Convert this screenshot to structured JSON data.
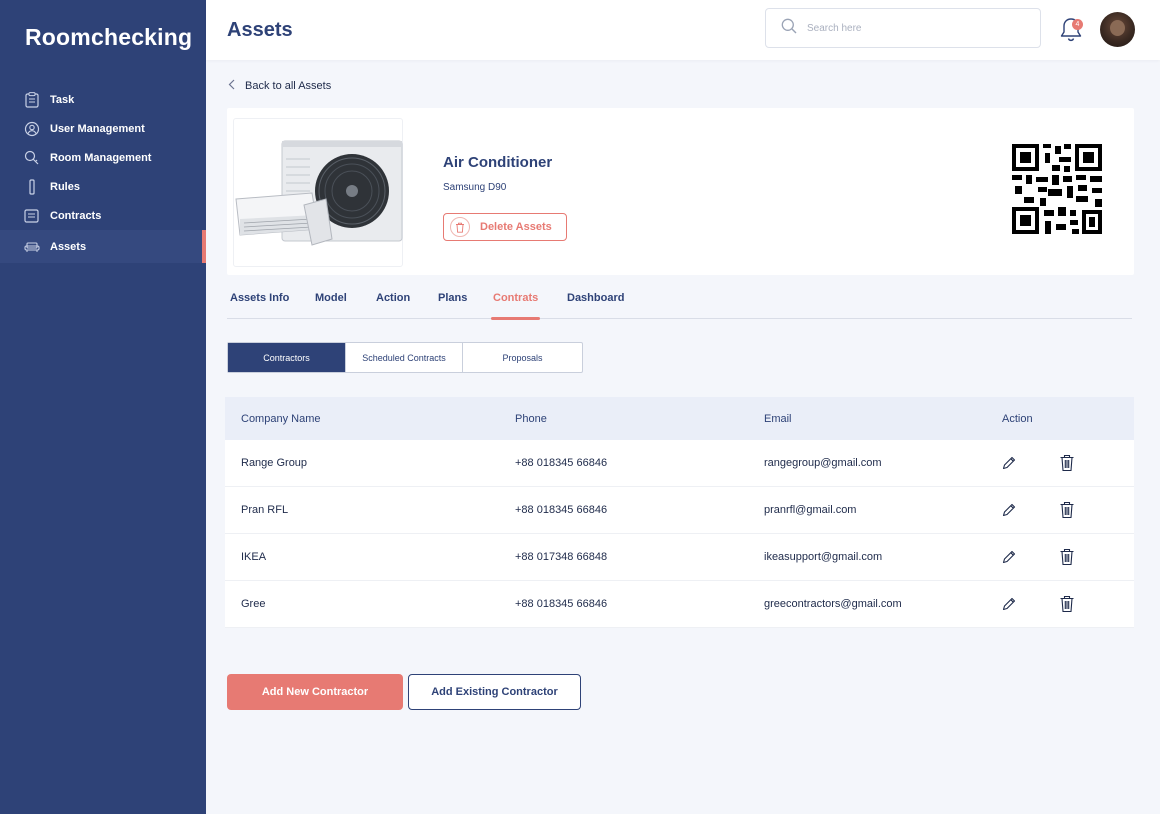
{
  "app": {
    "brand": "Roomchecking"
  },
  "sidebar": {
    "items": [
      {
        "label": "Task",
        "icon": "clipboard-icon"
      },
      {
        "label": "User Management",
        "icon": "users-icon"
      },
      {
        "label": "Room Management",
        "icon": "door-icon"
      },
      {
        "label": "Rules",
        "icon": "rules-icon"
      },
      {
        "label": "Contracts",
        "icon": "contract-icon"
      },
      {
        "label": "Assets",
        "icon": "sofa-icon",
        "active": true
      }
    ]
  },
  "header": {
    "title": "Assets",
    "search_placeholder": "Search here",
    "notification_count": "4"
  },
  "back_link": "Back to all Assets",
  "asset": {
    "name": "Air Conditioner",
    "model": "Samsung D90",
    "delete_label": "Delete Assets"
  },
  "tabs": [
    {
      "label": "Assets Info"
    },
    {
      "label": "Model"
    },
    {
      "label": "Action"
    },
    {
      "label": "Plans"
    },
    {
      "label": "Contrats",
      "active": true
    },
    {
      "label": "Dashboard"
    }
  ],
  "segments": [
    {
      "label": "Contractors",
      "active": true
    },
    {
      "label": "Scheduled Contracts"
    },
    {
      "label": "Proposals"
    }
  ],
  "table": {
    "columns": [
      "Company Name",
      "Phone",
      "Email",
      "Action"
    ],
    "rows": [
      {
        "company": "Range Group",
        "phone": "+88 018345 66846",
        "email": "rangegroup@gmail.com"
      },
      {
        "company": "Pran RFL",
        "phone": "+88 018345 66846",
        "email": "pranrfl@gmail.com"
      },
      {
        "company": "IKEA",
        "phone": "+88 017348 66848",
        "email": "ikeasupport@gmail.com"
      },
      {
        "company": "Gree",
        "phone": "+88 018345 66846",
        "email": "greecontractors@gmail.com"
      }
    ]
  },
  "buttons": {
    "add_new": "Add New Contractor",
    "add_existing": "Add Existing Contractor"
  },
  "colors": {
    "sidebar": "#2e4277",
    "accent": "#e77a73",
    "background": "#f4f6fb"
  }
}
